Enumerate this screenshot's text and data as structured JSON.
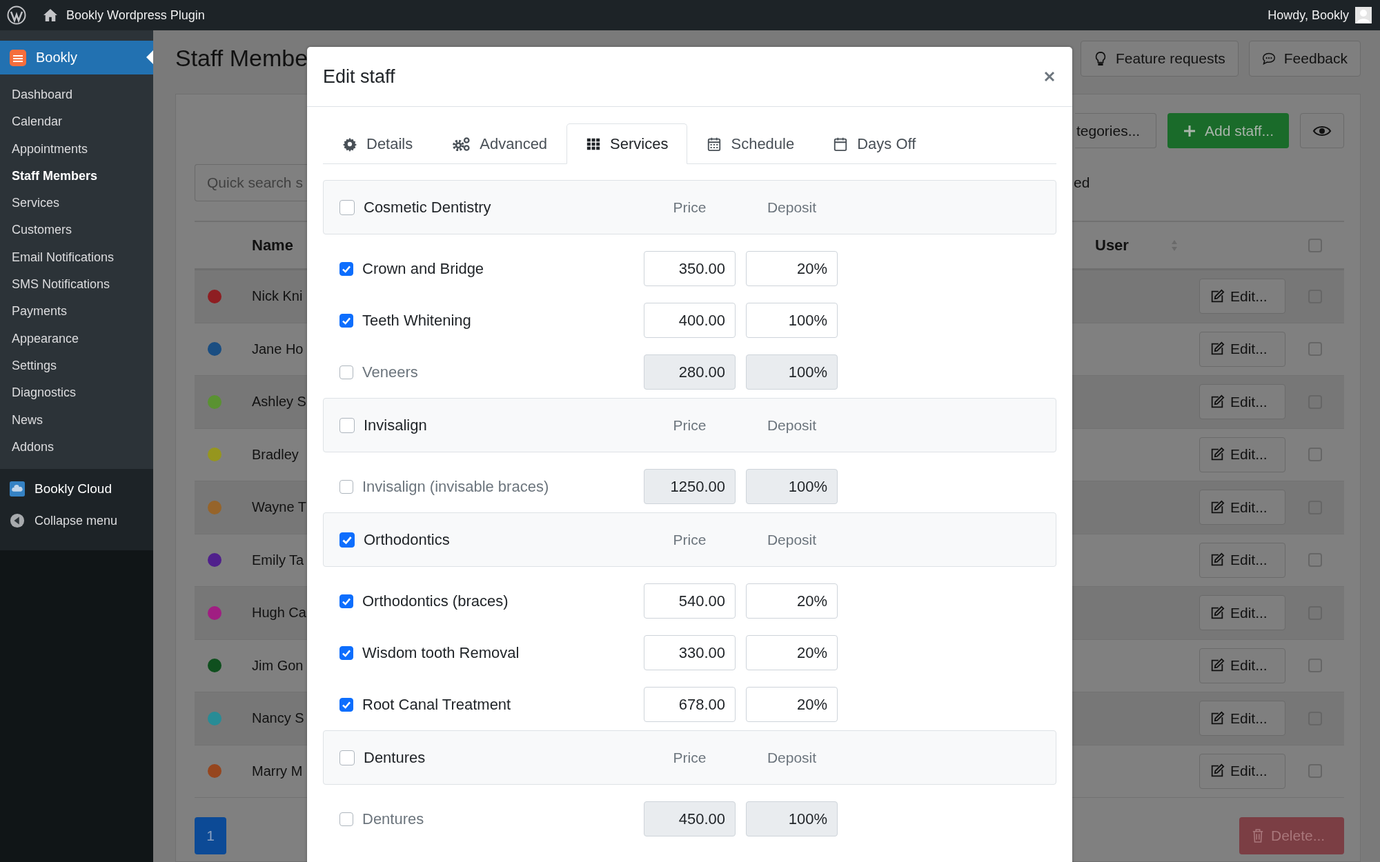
{
  "admin_bar": {
    "site_title": "Bookly Wordpress Plugin",
    "greeting": "Howdy, Bookly"
  },
  "sidebar": {
    "plugin": {
      "label": "Bookly",
      "selected": true
    },
    "items": [
      {
        "label": "Dashboard",
        "selected": false
      },
      {
        "label": "Calendar",
        "selected": false
      },
      {
        "label": "Appointments",
        "selected": false
      },
      {
        "label": "Staff Members",
        "selected": true
      },
      {
        "label": "Services",
        "selected": false
      },
      {
        "label": "Customers",
        "selected": false
      },
      {
        "label": "Email Notifications",
        "selected": false
      },
      {
        "label": "SMS Notifications",
        "selected": false
      },
      {
        "label": "Payments",
        "selected": false
      },
      {
        "label": "Appearance",
        "selected": false
      },
      {
        "label": "Settings",
        "selected": false
      },
      {
        "label": "Diagnostics",
        "selected": false
      },
      {
        "label": "News",
        "selected": false
      },
      {
        "label": "Addons",
        "selected": false
      }
    ],
    "footer_items": [
      {
        "label": "Bookly Cloud"
      },
      {
        "label": "Collapse menu"
      }
    ]
  },
  "page": {
    "title": "Staff Membe",
    "header_buttons": [
      "Feature requests",
      "Feedback"
    ],
    "toolbar": {
      "categories_button": "tegories...",
      "add_button": "Add staff..."
    },
    "search": {
      "placeholder": "Quick search s"
    },
    "filter_text": "ed",
    "table": {
      "columns": [
        "Name",
        "User"
      ],
      "select_all": {
        "checked": false
      },
      "rows": [
        {
          "name": "Nick Kni",
          "color": "#8e1e22",
          "edit": "Edit...",
          "checked": false
        },
        {
          "name": "Jane Ho",
          "color": "#1a4e82",
          "edit": "Edit...",
          "checked": false
        },
        {
          "name": "Ashley S",
          "color": "#5a9232",
          "edit": "Edit...",
          "checked": false
        },
        {
          "name": "Bradley",
          "color": "#96961e",
          "edit": "Edit...",
          "checked": false
        },
        {
          "name": "Wayne T",
          "color": "#96642a",
          "edit": "Edit...",
          "checked": false
        },
        {
          "name": "Emily Ta",
          "color": "#50208c",
          "edit": "Edit...",
          "checked": false
        },
        {
          "name": "Hugh Ca",
          "color": "#a01e82",
          "edit": "Edit...",
          "checked": false
        },
        {
          "name": "Jim Gon",
          "color": "#0f4f1e",
          "edit": "Edit...",
          "checked": false
        },
        {
          "name": "Nancy S",
          "color": "#288c96",
          "edit": "Edit...",
          "checked": false
        },
        {
          "name": "Marry M",
          "color": "#96461e",
          "edit": "Edit...",
          "checked": false
        }
      ]
    },
    "pagination": [
      {
        "label": "1",
        "selected": true
      }
    ],
    "delete_button": {
      "label": "Delete...",
      "disabled": true
    }
  },
  "modal": {
    "title": "Edit staff",
    "tabs": [
      {
        "label": "Details",
        "selected": false
      },
      {
        "label": "Advanced",
        "selected": false
      },
      {
        "label": "Services",
        "selected": true
      },
      {
        "label": "Schedule",
        "selected": false
      },
      {
        "label": "Days Off",
        "selected": false
      }
    ],
    "categories": [
      {
        "name": "Cosmetic Dentistry",
        "checked": false,
        "price_label": "Price",
        "deposit_label": "Deposit",
        "services": [
          {
            "name": "Crown and Bridge",
            "checked": true,
            "price": "350.00",
            "deposit": "20%"
          },
          {
            "name": "Teeth Whitening",
            "checked": true,
            "price": "400.00",
            "deposit": "100%"
          },
          {
            "name": "Veneers",
            "checked": false,
            "price": "280.00",
            "deposit": "100%"
          }
        ]
      },
      {
        "name": "Invisalign",
        "checked": false,
        "price_label": "Price",
        "deposit_label": "Deposit",
        "services": [
          {
            "name": "Invisalign (invisable braces)",
            "checked": false,
            "price": "1250.00",
            "deposit": "100%"
          }
        ]
      },
      {
        "name": "Orthodontics",
        "checked": true,
        "price_label": "Price",
        "deposit_label": "Deposit",
        "services": [
          {
            "name": "Orthodontics (braces)",
            "checked": true,
            "price": "540.00",
            "deposit": "20%"
          },
          {
            "name": "Wisdom tooth Removal",
            "checked": true,
            "price": "330.00",
            "deposit": "20%"
          },
          {
            "name": "Root Canal Treatment",
            "checked": true,
            "price": "678.00",
            "deposit": "20%"
          }
        ]
      },
      {
        "name": "Dentures",
        "checked": false,
        "price_label": "Price",
        "deposit_label": "Deposit",
        "services": [
          {
            "name": "Dentures",
            "checked": false,
            "price": "450.00",
            "deposit": "100%"
          }
        ]
      }
    ]
  }
}
